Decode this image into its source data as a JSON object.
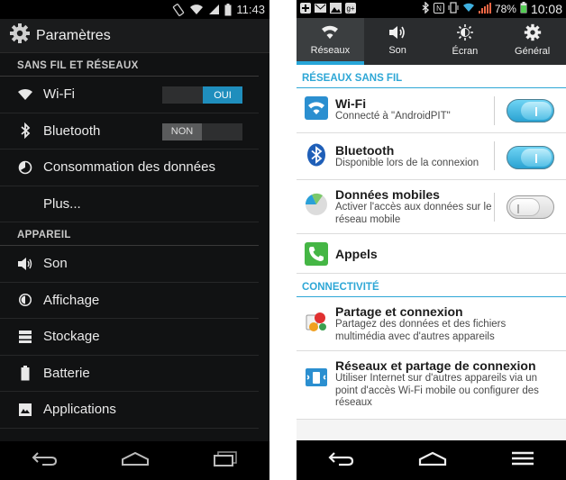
{
  "left_phone": {
    "status": {
      "time": "11:43"
    },
    "action_bar": {
      "title": "Paramètres",
      "icon": "gear-icon"
    },
    "sections": [
      {
        "header": "SANS FIL ET RÉSEAUX"
      },
      {
        "header": "APPAREIL"
      }
    ],
    "rows": {
      "wifi": {
        "label": "Wi-Fi",
        "switch_text": "OUI",
        "state": "on"
      },
      "bluetooth": {
        "label": "Bluetooth",
        "switch_text": "NON",
        "state": "off"
      },
      "data": {
        "label": "Consommation des données"
      },
      "plus": {
        "label": "Plus..."
      },
      "sound": {
        "label": "Son"
      },
      "display": {
        "label": "Affichage"
      },
      "storage": {
        "label": "Stockage"
      },
      "battery": {
        "label": "Batterie"
      },
      "apps": {
        "label": "Applications"
      }
    },
    "colors": {
      "accent": "#1f8ebd",
      "background": "#111213"
    }
  },
  "right_phone": {
    "status": {
      "battery": "78%",
      "time": "10:08"
    },
    "tabs": [
      {
        "label": "Réseaux",
        "icon": "wifi-icon",
        "active": true
      },
      {
        "label": "Son",
        "icon": "speaker-icon",
        "active": false
      },
      {
        "label": "Écran",
        "icon": "brightness-icon",
        "active": false
      },
      {
        "label": "Général",
        "icon": "gear-icon",
        "active": false
      }
    ],
    "sections": [
      {
        "header": "RÉSEAUX SANS FIL"
      },
      {
        "header": "CONNECTIVITÉ"
      }
    ],
    "rows": {
      "wifi": {
        "title": "Wi-Fi",
        "subtitle": "Connecté à \"AndroidPIT\"",
        "state": "on"
      },
      "bluetooth": {
        "title": "Bluetooth",
        "subtitle": "Disponible lors de la connexion",
        "state": "on"
      },
      "mobile_data": {
        "title": "Données mobiles",
        "subtitle": "Activer l'accès aux données sur le réseau mobile",
        "state": "off"
      },
      "calls": {
        "title": "Appels"
      },
      "share": {
        "title": "Partage et connexion",
        "subtitle": "Partagez des données et des fichiers multimédia avec d'autres appareils"
      },
      "tethering": {
        "title": "Réseaux et partage de connexion",
        "subtitle": "Utiliser Internet sur d'autres appareils via un point d'accès Wi-Fi mobile ou configurer des réseaux"
      }
    },
    "colors": {
      "accent": "#2ea7d6",
      "background": "#ffffff"
    }
  }
}
